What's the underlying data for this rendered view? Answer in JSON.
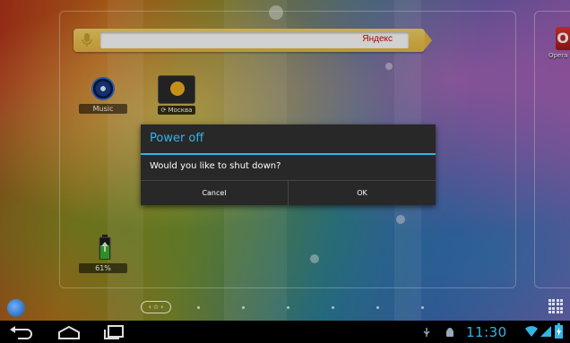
{
  "search": {
    "brand": "Яндекс"
  },
  "apps": {
    "music_label": "Music",
    "weather_label": "⟳ Москва",
    "battery_label": "61%",
    "opera_label": "Opera M"
  },
  "dialog": {
    "title": "Power off",
    "message": "Would you like to shut down?",
    "cancel_label": "Cancel",
    "ok_label": "OK"
  },
  "dock": {
    "page_indicator": "‹ ☆ ›"
  },
  "status": {
    "time": "11:30",
    "battery_percent": 61,
    "accent_color": "#33b5e5"
  },
  "icons": [
    "microphone-icon",
    "music-app-icon",
    "weather-app-icon",
    "battery-widget-icon",
    "opera-app-icon",
    "globe-icon",
    "all-apps-icon",
    "back-icon",
    "home-icon",
    "recent-apps-icon",
    "usb-icon",
    "android-debug-icon",
    "wifi-icon",
    "signal-icon",
    "battery-status-icon"
  ]
}
